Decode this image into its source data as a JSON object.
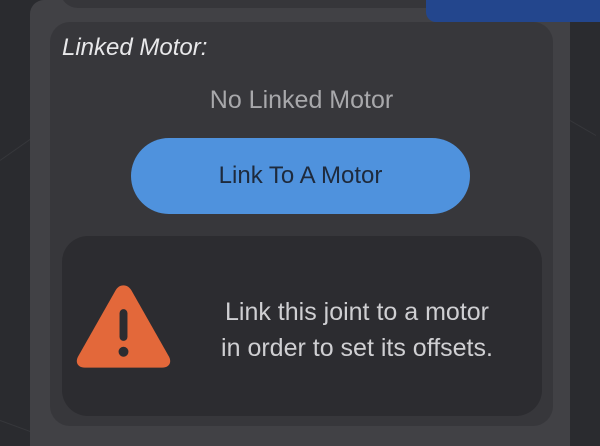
{
  "linked_motor_section": {
    "label": "Linked Motor:",
    "status": "No Linked Motor",
    "link_button_label": "Link To A Motor"
  },
  "warning": {
    "icon": "warning-triangle-icon",
    "line1": "Link this joint to a motor",
    "line2": "in order to set its offsets."
  },
  "colors": {
    "background": "#2a2b2f",
    "panel": "#414145",
    "card": "#37373b",
    "warning_box": "#2c2c30",
    "button": "#4f92dd",
    "warning_icon": "#e3683a",
    "accent_blue": "#23468d"
  }
}
